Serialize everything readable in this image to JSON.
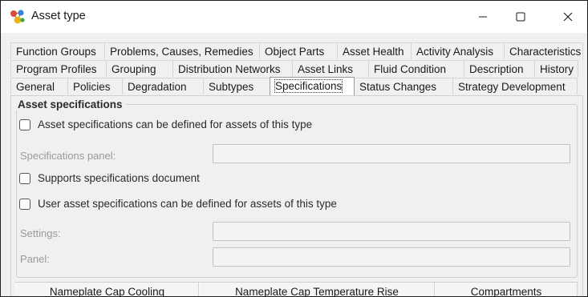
{
  "window": {
    "title": "Asset type",
    "icon": "asset-type-app-icon",
    "controls": {
      "minimize": "minimize-icon",
      "maximize": "maximize-icon",
      "close": "close-icon"
    }
  },
  "tabs": {
    "row1": [
      "Function Groups",
      "Problems, Causes, Remedies",
      "Object Parts",
      "Asset Health",
      "Activity Analysis",
      "Characteristics"
    ],
    "row2": [
      "Program Profiles",
      "Grouping",
      "Distribution Networks",
      "Asset Links",
      "Fluid Condition",
      "Description",
      "History"
    ],
    "row3": [
      "General",
      "Policies",
      "Degradation",
      "Subtypes",
      "Specifications",
      "Status Changes",
      "Strategy Development"
    ],
    "active": "Specifications"
  },
  "specifications": {
    "group_title": "Asset specifications",
    "asset_specs_checkbox": {
      "label": "Asset specifications can be defined for assets of this type",
      "checked": false
    },
    "specifications_panel_label": "Specifications panel:",
    "specifications_panel_value": "",
    "supports_document_checkbox": {
      "label": "Supports specifications document",
      "checked": false
    },
    "user_specs_checkbox": {
      "label": "User asset specifications can be defined for assets of this type",
      "checked": false
    },
    "settings_label": "Settings:",
    "settings_value": "",
    "panel_label": "Panel:",
    "panel_value": ""
  },
  "table": {
    "columns": [
      "Nameplate Cap Cooling",
      "Nameplate Cap Temperature Rise",
      "Compartments"
    ]
  },
  "colors": {
    "window_bg": "#f0f0f0",
    "titlebar_bg": "#ffffff",
    "border": "#1f1f1f"
  }
}
